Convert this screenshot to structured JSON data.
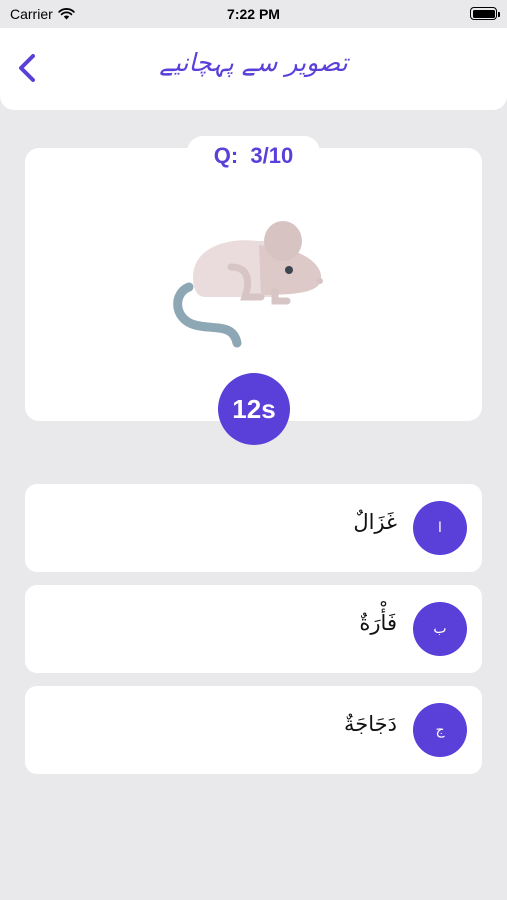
{
  "status_bar": {
    "carrier": "Carrier",
    "time": "7:22 PM"
  },
  "header": {
    "title": "تصویر سے پہچانیے",
    "back_icon": "chevron-left-icon"
  },
  "question": {
    "counter": "Q:  3/10",
    "image": "mouse-illustration",
    "timer": "12s"
  },
  "options": [
    {
      "letter": "ا",
      "text": "غَزَالٌ"
    },
    {
      "letter": "ب",
      "text": "فَأْرَةٌ"
    },
    {
      "letter": "ج",
      "text": "دَجَاجَةٌ"
    }
  ],
  "colors": {
    "accent": "#5b3fd9",
    "background": "#e9e9eb",
    "card": "#ffffff"
  }
}
